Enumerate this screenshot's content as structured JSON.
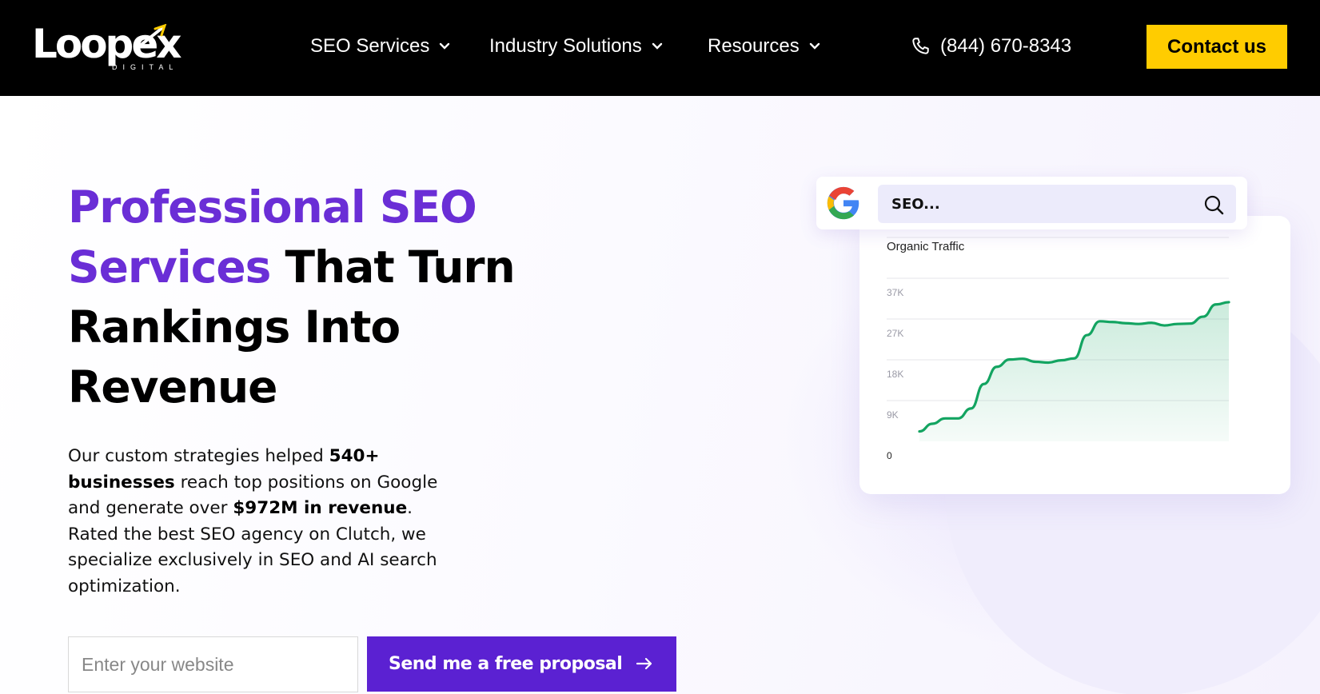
{
  "header": {
    "logo_text": "Loopex",
    "logo_subtext": "DIGITAL",
    "nav": [
      {
        "label": "SEO Services"
      },
      {
        "label": "Industry Solutions"
      },
      {
        "label": "Resources"
      }
    ],
    "phone": "(844) 670-8343",
    "contact_label": "Contact us"
  },
  "hero": {
    "headline_accent_1": "Professional SEO",
    "headline_accent_2": "Services",
    "headline_rest_1": " That Turn",
    "headline_rest_2": "Rankings Into",
    "headline_rest_3": "Revenue",
    "lead_1": "Our custom strategies helped ",
    "lead_b1": "540+ businesses",
    "lead_2": " reach top positions on Google and generate over ",
    "lead_b2": "$972M in revenue",
    "lead_3": ". Rated the best SEO agency on Clutch, we specialize exclusively in SEO and AI search optimization.",
    "input_placeholder": "Enter your website",
    "cta_label": "Send me a free proposal"
  },
  "search_widget": {
    "query": "SEO..."
  },
  "colors": {
    "accent_purple": "#6a2ed6",
    "button_purple": "#5b21d2",
    "contact_yellow": "#ffcc00",
    "chart_line": "#13a461"
  },
  "chart_data": {
    "type": "area",
    "title": "Organic Traffic",
    "y_tick_labels": [
      "0",
      "9K",
      "18K",
      "27K",
      "37K"
    ],
    "ylim": [
      0,
      46000
    ],
    "x": [
      0,
      1,
      2,
      3,
      4,
      5,
      6,
      7,
      8,
      9,
      10,
      11,
      12,
      13,
      14,
      15,
      16,
      17,
      18,
      19,
      20,
      21,
      22,
      23,
      24
    ],
    "values": [
      2600,
      4600,
      6000,
      6000,
      8600,
      15000,
      19500,
      21400,
      21600,
      20800,
      20600,
      21200,
      21700,
      27800,
      31400,
      31200,
      30900,
      30700,
      31000,
      30300,
      30700,
      30800,
      32600,
      35800,
      36400
    ],
    "grid": true,
    "legend": "none"
  }
}
